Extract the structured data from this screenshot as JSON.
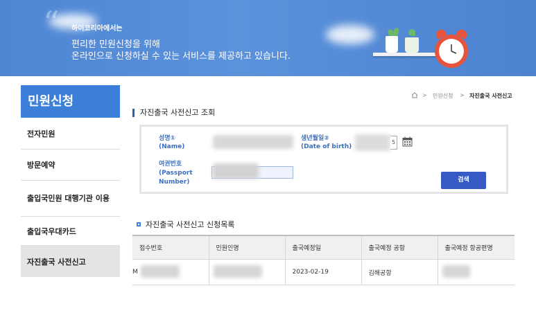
{
  "banner": {
    "line1": "하이코리아에서는",
    "line2": "편리한 민원신청을 위해",
    "line3": "온라인으로 신청하실 수 있는 서비스를 제공하고 있습니다."
  },
  "sidebar": {
    "title": "민원신청",
    "items": [
      {
        "label": "전자민원"
      },
      {
        "label": "방문예약"
      },
      {
        "label": "출입국민원 대행기관 이용"
      },
      {
        "label": "출입국우대카드"
      },
      {
        "label": "자진출국 사전신고"
      }
    ]
  },
  "breadcrumb": {
    "home_icon": "home-icon",
    "items": [
      "민원신청",
      "자진출국 사전신고"
    ]
  },
  "search": {
    "title": "자진출국 사전신고 조회",
    "name_label": "성명①",
    "name_label_en": "(Name)",
    "dob_label": "생년월일②",
    "dob_label_en": "(Date of birth)",
    "passport_label": "여권번호",
    "passport_label_en1": "(Passport",
    "passport_label_en2": "Number)",
    "date_suffix": "5",
    "calendar_icon": "calendar-icon",
    "button_label": "검색"
  },
  "list": {
    "title": "자진출국 사전신고 신청목록",
    "columns": [
      "접수번호",
      "민원인명",
      "출국예정일",
      "출국예정 공항",
      "출국예정 항공편명"
    ],
    "rows": [
      {
        "receipt_no": "M",
        "name": "",
        "date": "2023-02-19",
        "airport": "김해공항",
        "flight": ""
      }
    ]
  },
  "colors": {
    "banner": "#4f86d4",
    "sidebar_title": "#3b7fd8",
    "search_button": "#3759c4",
    "active_item": "#e4e4e4"
  }
}
